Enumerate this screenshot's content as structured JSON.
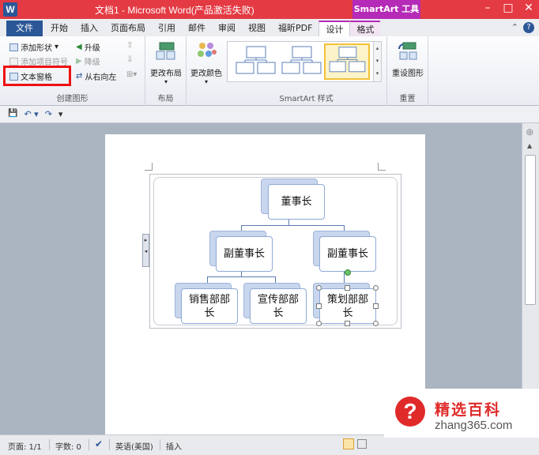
{
  "window": {
    "app_icon": "W",
    "title": "文档1 - Microsoft Word(产品激活失败)",
    "context_title": "SmartArt 工具",
    "controls": [
      "–",
      "□",
      "✕"
    ]
  },
  "tabs": {
    "file": "文件",
    "items": [
      "开始",
      "插入",
      "页面布局",
      "引用",
      "邮件",
      "审阅",
      "视图",
      "福昕PDF"
    ],
    "context": [
      "设计",
      "格式"
    ],
    "active": "设计",
    "right_icons": [
      "help-icon",
      "collapse-ribbon-icon"
    ],
    "right_glyphs": [
      "?",
      "⌃"
    ]
  },
  "ribbon": {
    "create_group": {
      "label": "创建图形",
      "add_shape": "添加形状",
      "add_bullet": "添加项目符号",
      "text_pane": "文本窗格",
      "promote": "升级",
      "demote": "降级",
      "rtl": "从右向左"
    },
    "layout_group": {
      "label": "布局",
      "change_layout": "更改布局"
    },
    "colors": {
      "change_colors": "更改颜色"
    },
    "styles_group": {
      "label": "SmartArt 样式"
    },
    "reset_group": {
      "label": "重置",
      "reset_graphic": "重设图形"
    }
  },
  "qat": {
    "icons": [
      "save-icon",
      "undo-icon",
      "redo-icon",
      "customize-icon"
    ],
    "glyphs": [
      "💾",
      "↶ ▾",
      "↷",
      "▾"
    ]
  },
  "smartart": {
    "handle_glyphs": "▸\n◂",
    "nodes": {
      "chairman": "董事长",
      "vice_left": "副董事长",
      "vice_right": "副董事长",
      "sales": "销售部部长",
      "pr": "宣传部部长",
      "planning": "策划部部长"
    }
  },
  "statusbar": {
    "page": "页面: 1/1",
    "words": "字数: 0",
    "language": "英语(美国)",
    "mode": "插入"
  },
  "watermark": {
    "brand": "精选百科",
    "url": "zhang365.com"
  },
  "colors": {
    "titlebar": "#e43a43",
    "context_tab": "#b52ab7",
    "file_tab": "#2b5797",
    "highlight": "#e11111",
    "node_border": "#8eaad6"
  }
}
